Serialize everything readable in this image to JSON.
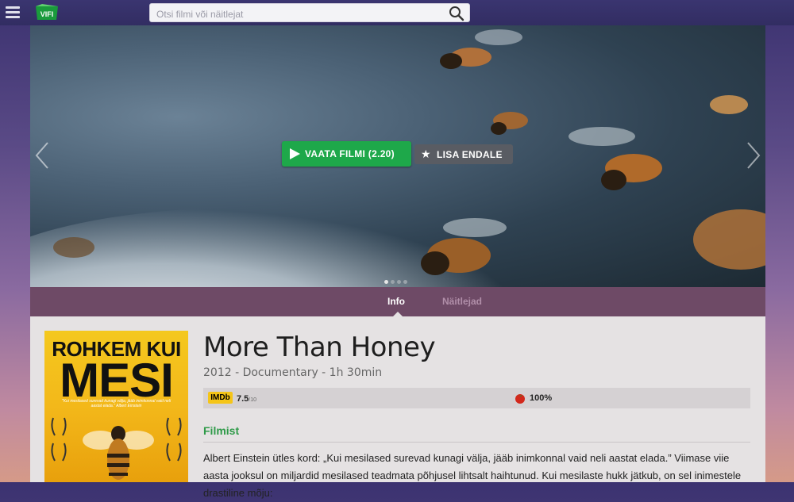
{
  "header": {
    "logo_text": "VIFI",
    "search_placeholder": "Otsi filmi või näitlejat"
  },
  "hero": {
    "play_label": "VAATA FILMI (2.20)",
    "add_label": "LISA ENDALE",
    "slide_count": 4,
    "active_slide": 1
  },
  "tabs": {
    "info": "Info",
    "actors": "Näitlejad",
    "active": "info"
  },
  "movie": {
    "title": "More Than Honey",
    "meta": "2012 - Documentary - 1h 30min",
    "imdb_label": "IMDb",
    "imdb_score": "7.5",
    "imdb_scale": "/10",
    "tomato_score": "100%",
    "section_heading": "Filmist",
    "description": "Albert Einstein ütles kord: „Kui mesilased surevad kunagi välja, jääb inimkonnal vaid neli aastat elada.” Viimase viie aasta jooksul on miljardid mesilased teadmata põhjusel lihtsalt haihtunud. Kui mesilaste hukk jätkub, on sel inimestele drastiline mõju:"
  },
  "poster": {
    "title_line1": "ROHKEM KUI",
    "title_line2": "MESI",
    "quote": "\"Kui mesilased surevad kunagi välja, jääb inimkonnal vaid neli aastat elada.\" Albert Einstein"
  },
  "colors": {
    "accent_green": "#1ea84a",
    "tab_bar": "#6e4a66",
    "imdb_yellow": "#f5c518"
  }
}
